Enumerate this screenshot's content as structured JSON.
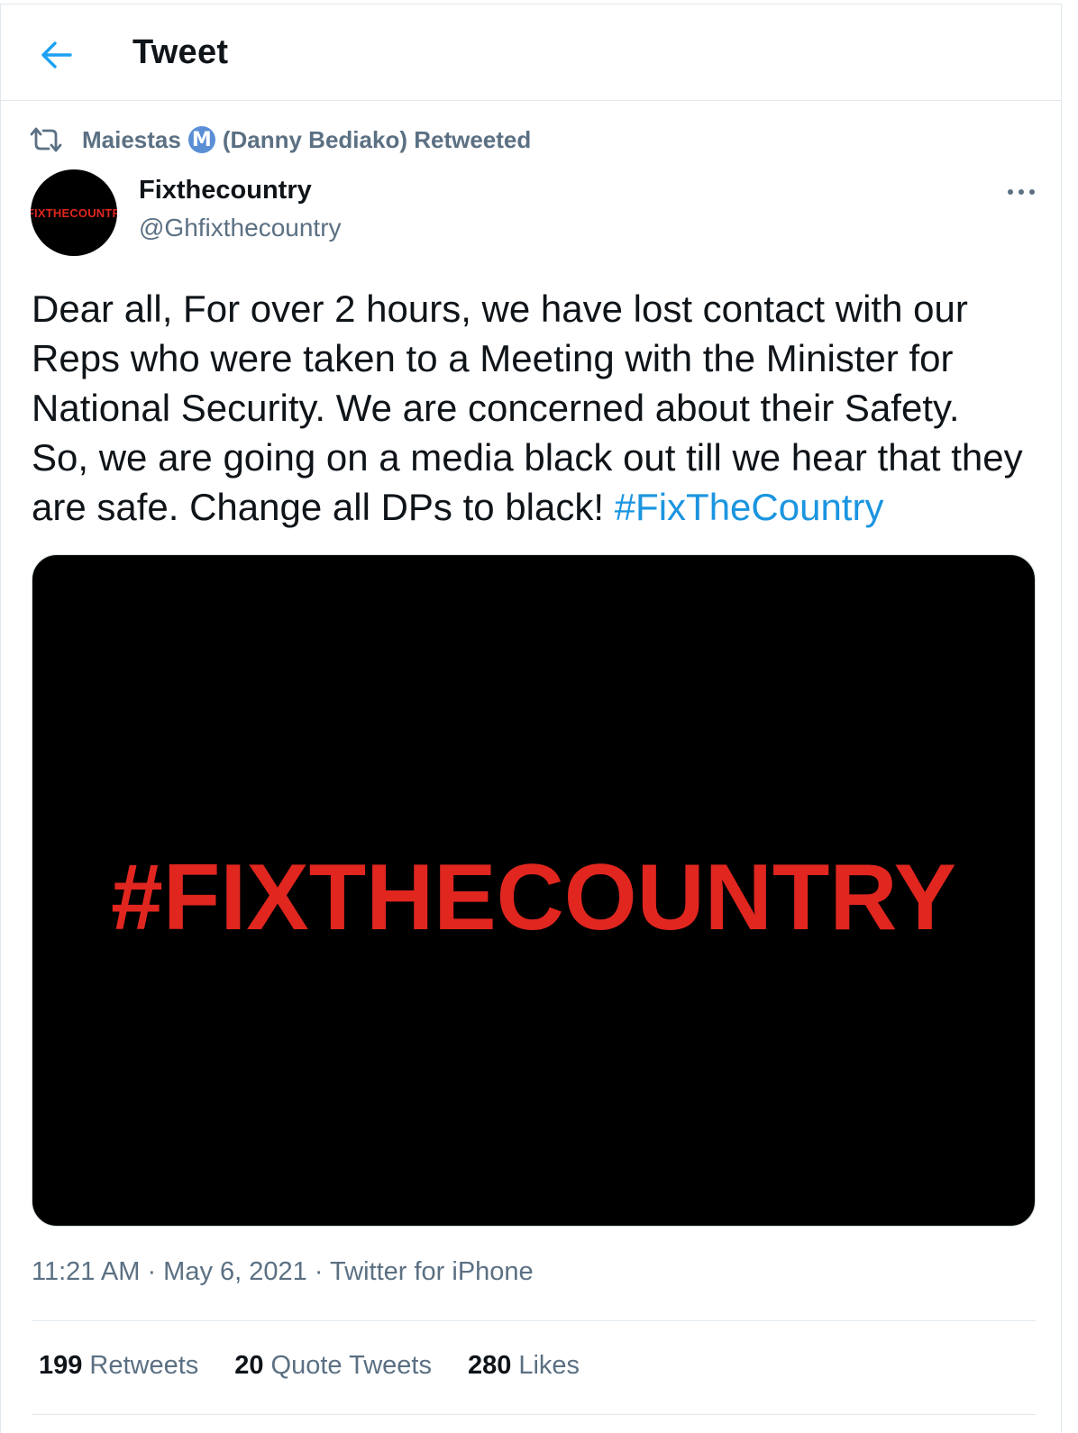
{
  "header": {
    "title": "Tweet",
    "back_icon": "arrow-left-icon"
  },
  "retweet_context": {
    "icon": "retweet-icon",
    "name": "Maiestas",
    "badge": "M",
    "rest": "(Danny Bediako) Retweeted"
  },
  "author": {
    "avatar_text": "FIXTHECOUNTR",
    "name": "Fixthecountry",
    "handle": "@Ghfixthecountry"
  },
  "tweet": {
    "text": "Dear all, For over 2 hours, we have lost contact with our Reps who were taken to a Meeting with the Minister for National Security. We are concerned about their Safety. So, we are going on a media black out till we hear that they are safe. Change all DPs to black! ",
    "hashtag": "#FixTheCountry",
    "media_text": "#FIXTHECOUNTRY"
  },
  "meta": {
    "time": "11:21 AM",
    "sep1": " · ",
    "date": "May 6, 2021",
    "sep2": " · ",
    "source": "Twitter for iPhone"
  },
  "stats": {
    "retweets_count": "199",
    "retweets_label": "Retweets",
    "quotes_count": "20",
    "quotes_label": "Quote Tweets",
    "likes_count": "280",
    "likes_label": "Likes"
  },
  "colors": {
    "accent": "#1b95e0",
    "secondary_text": "#5b7083",
    "media_red": "#e0261f"
  }
}
